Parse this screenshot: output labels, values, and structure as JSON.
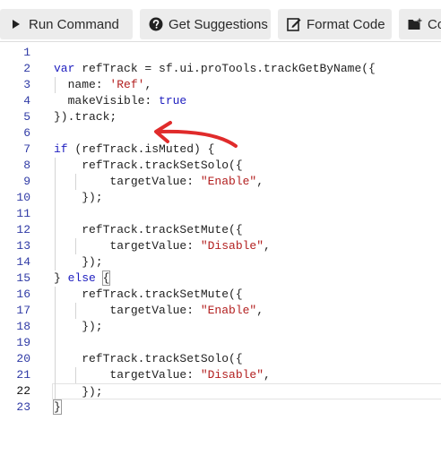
{
  "toolbar": {
    "run_label": "Run Command",
    "suggest_label": "Get Suggestions",
    "format_label": "Format Code",
    "more_label": "Co",
    "icons": {
      "run": "play-icon",
      "suggest": "question-circle-icon",
      "format": "edit-icon",
      "more": "folder-add-icon"
    }
  },
  "editor": {
    "line_numbers": [
      "1",
      "2",
      "3",
      "4",
      "5",
      "6",
      "7",
      "8",
      "9",
      "10",
      "11",
      "12",
      "13",
      "14",
      "15",
      "16",
      "17",
      "18",
      "19",
      "20",
      "21",
      "22",
      "23"
    ],
    "current_line": "22",
    "lines": [
      [],
      [
        {
          "t": "kw",
          "v": "var"
        },
        {
          "t": "plain",
          "v": " refTrack = sf.ui.proTools.trackGetByName({"
        }
      ],
      [
        {
          "t": "plain",
          "v": "  name: "
        },
        {
          "t": "str",
          "v": "'Ref'"
        },
        {
          "t": "plain",
          "v": ","
        }
      ],
      [
        {
          "t": "plain",
          "v": "  makeVisible: "
        },
        {
          "t": "kw",
          "v": "true"
        }
      ],
      [
        {
          "t": "plain",
          "v": "}).track;"
        }
      ],
      [],
      [
        {
          "t": "kw",
          "v": "if"
        },
        {
          "t": "plain",
          "v": " (refTrack.isMuted) {"
        }
      ],
      [
        {
          "t": "plain",
          "v": "    refTrack.trackSetSolo({"
        }
      ],
      [
        {
          "t": "plain",
          "v": "        targetValue: "
        },
        {
          "t": "str",
          "v": "\"Enable\""
        },
        {
          "t": "plain",
          "v": ","
        }
      ],
      [
        {
          "t": "plain",
          "v": "    });"
        }
      ],
      [],
      [
        {
          "t": "plain",
          "v": "    refTrack.trackSetMute({"
        }
      ],
      [
        {
          "t": "plain",
          "v": "        targetValue: "
        },
        {
          "t": "str",
          "v": "\"Disable\""
        },
        {
          "t": "plain",
          "v": ","
        }
      ],
      [
        {
          "t": "plain",
          "v": "    });"
        }
      ],
      [
        {
          "t": "plain",
          "v": "} "
        },
        {
          "t": "kw",
          "v": "else"
        },
        {
          "t": "plain",
          "v": " "
        },
        {
          "t": "bracket",
          "v": "{"
        }
      ],
      [
        {
          "t": "plain",
          "v": "    refTrack.trackSetMute({"
        }
      ],
      [
        {
          "t": "plain",
          "v": "        targetValue: "
        },
        {
          "t": "str",
          "v": "\"Enable\""
        },
        {
          "t": "plain",
          "v": ","
        }
      ],
      [
        {
          "t": "plain",
          "v": "    });"
        }
      ],
      [],
      [
        {
          "t": "plain",
          "v": "    refTrack.trackSetSolo({"
        }
      ],
      [
        {
          "t": "plain",
          "v": "        targetValue: "
        },
        {
          "t": "str",
          "v": "\"Disable\""
        },
        {
          "t": "plain",
          "v": ","
        }
      ],
      [
        {
          "t": "plain",
          "v": "    });"
        }
      ],
      [
        {
          "t": "bracket",
          "v": "}"
        }
      ]
    ]
  },
  "colors": {
    "keyword": "#1d1dbf",
    "string": "#b32020",
    "line_number": "#2f3aa5",
    "annotation_arrow": "#e02b2b",
    "button_bg": "#ececec"
  }
}
